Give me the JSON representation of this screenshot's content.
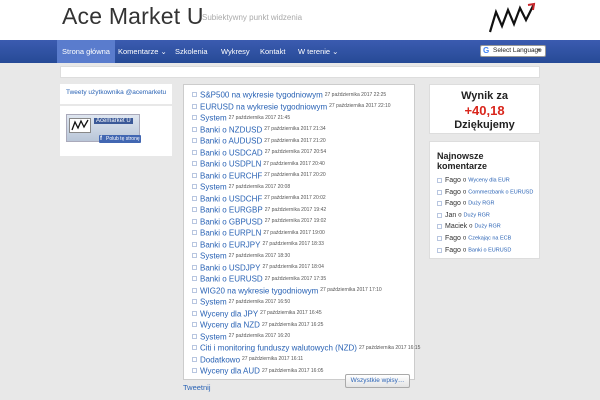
{
  "header": {
    "title": "Ace Market U",
    "tagline": "Subiektywny punkt widzenia",
    "logo_icon": "acemarket-logo-chart-arrow"
  },
  "nav": {
    "items": [
      {
        "label": "Strona główna",
        "active": true
      },
      {
        "label": "Komentarze ⌄"
      },
      {
        "label": "Szkolenia"
      },
      {
        "label": "Wykresy"
      },
      {
        "label": "Kontakt"
      },
      {
        "label": "W terenie ⌄"
      }
    ],
    "language": {
      "google": "G",
      "label": "Select Language",
      "arrow": "▼"
    }
  },
  "left": {
    "tweets_link": "Tweety użytkownika @acemarketu",
    "fb": {
      "page_name": "Acemarket U",
      "like_label": "Polub tę stronę",
      "f": "f"
    }
  },
  "posts": [
    {
      "title": "S&P500 na wykresie tygodniowym",
      "date": "27 października 2017 22:25"
    },
    {
      "title": "EURUSD na wykresie tygodniowym",
      "date": "27 października 2017 22:10"
    },
    {
      "title": "System",
      "date": "27 października 2017 21:45"
    },
    {
      "title": "Banki o NZDUSD",
      "date": "27 października 2017 21:34"
    },
    {
      "title": "Banki o AUDUSD",
      "date": "27 października 2017 21:20"
    },
    {
      "title": "Banki o USDCAD",
      "date": "27 października 2017 20:54"
    },
    {
      "title": "Banki o USDPLN",
      "date": "27 października 2017 20:40"
    },
    {
      "title": "Banki o EURCHF",
      "date": "27 października 2017 20:20"
    },
    {
      "title": "System",
      "date": "27 października 2017 20:08"
    },
    {
      "title": "Banki o USDCHF",
      "date": "27 października 2017 20:02"
    },
    {
      "title": "Banki o EURGBP",
      "date": "27 października 2017 19:42"
    },
    {
      "title": "Banki o GBPUSD",
      "date": "27 października 2017 19:02"
    },
    {
      "title": "Banki o EURPLN",
      "date": "27 października 2017 19:00"
    },
    {
      "title": "Banki o EURJPY",
      "date": "27 października 2017 18:33"
    },
    {
      "title": "System",
      "date": "27 października 2017 18:30"
    },
    {
      "title": "Banki o USDJPY",
      "date": "27 października 2017 18:04"
    },
    {
      "title": "Banki o EURUSD",
      "date": "27 października 2017 17:35"
    },
    {
      "title": "WIG20 na wykresie tygodniowym",
      "date": "27 października 2017 17:10"
    },
    {
      "title": "System",
      "date": "27 października 2017 16:50"
    },
    {
      "title": "Wyceny dla JPY",
      "date": "27 października 2017 16:45"
    },
    {
      "title": "Wyceny dla NZD",
      "date": "27 października 2017 16:25"
    },
    {
      "title": "System",
      "date": "27 października 2017 16:20"
    },
    {
      "title": "Citi i monitoring funduszy walutowych (NZD)",
      "date": "27 października 2017 16:15"
    },
    {
      "title": "Dodatkowo",
      "date": "27 października 2017 16:11"
    },
    {
      "title": "Wyceny dla AUD",
      "date": "27 października 2017 16:05"
    }
  ],
  "all_posts_button": "Wszystkie wpisy…",
  "tweet_link": "Tweetnij",
  "result": {
    "line1": "Wynik za",
    "line2": "+40,18",
    "line3": "Dziękujemy",
    "value_color": "#d9261c"
  },
  "comments": {
    "heading_line1": "Najnowsze",
    "heading_line2": "komentarze",
    "items": [
      {
        "author": "Fago",
        "on": "o",
        "post": "Wyceny dla EUR"
      },
      {
        "author": "Fago",
        "on": "o",
        "post": "Commerzbank o EURUSD"
      },
      {
        "author": "Fago",
        "on": "o",
        "post": "Duży RGR"
      },
      {
        "author": "Jan",
        "on": "o",
        "post": "Duży RGR"
      },
      {
        "author": "Maciek",
        "on": "o",
        "post": "Duży RGR"
      },
      {
        "author": "Fago",
        "on": "o",
        "post": "Czekając na ECB"
      },
      {
        "author": "Fago",
        "on": "o",
        "post": "Banki o EURUSD"
      }
    ]
  },
  "colors": {
    "nav_bg": "#2f4f9f",
    "link": "#2a63b5",
    "nav_active": "#5a7ccd"
  }
}
